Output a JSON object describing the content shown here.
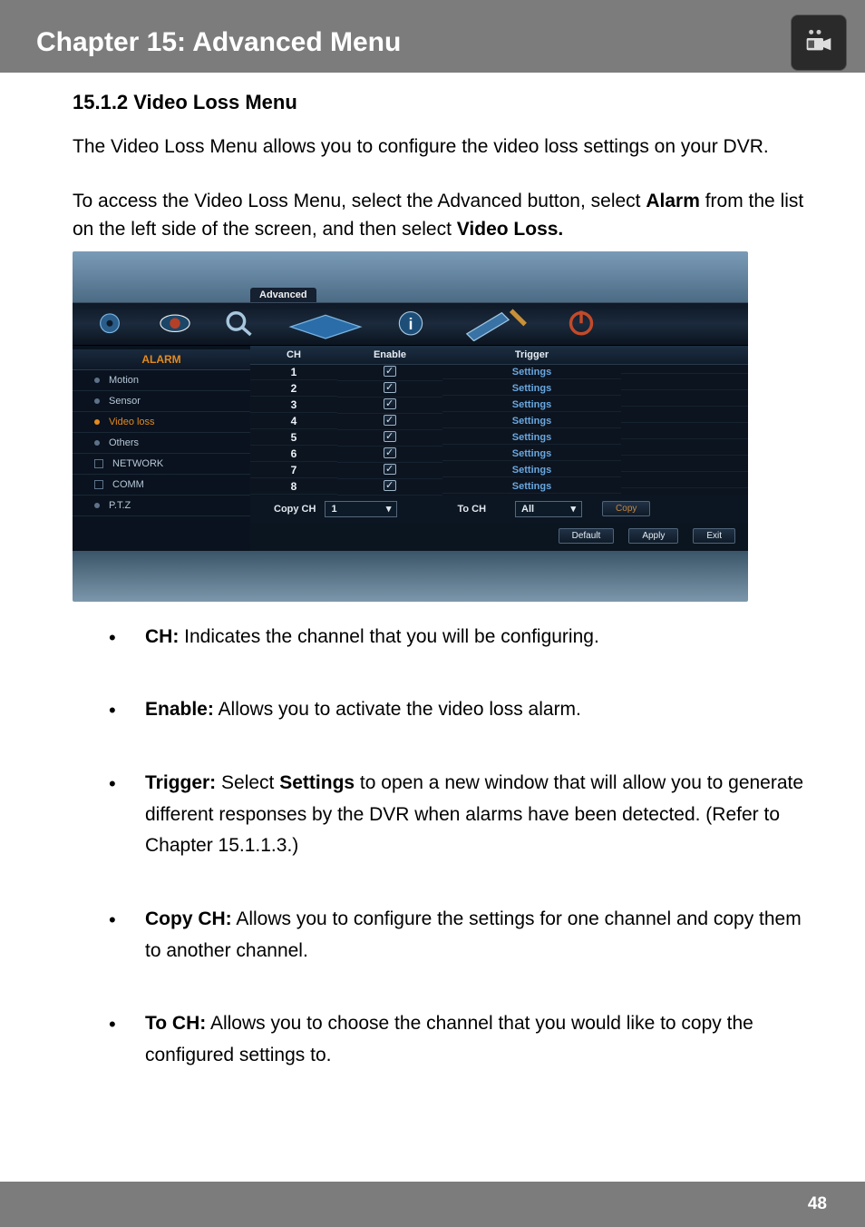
{
  "header": {
    "title": "Chapter 15: Advanced Menu"
  },
  "section": {
    "heading": "15.1.2 Video Loss Menu",
    "intro": "The Video Loss Menu allows you to configure the video loss settings on your DVR.",
    "instr_pre": "To access the Video Loss Menu, select the Advanced button, select ",
    "instr_b1": "Alarm",
    "instr_mid": " from the list on the left side of the screen, and then select ",
    "instr_b2": "Video Loss."
  },
  "dvr": {
    "window_title": "Advanced",
    "sidebar": {
      "heading": "ALARM",
      "items": [
        {
          "label": "Motion",
          "active": false
        },
        {
          "label": "Sensor",
          "active": false
        },
        {
          "label": "Video loss",
          "active": true
        },
        {
          "label": "Others",
          "active": false
        },
        {
          "label": "NETWORK",
          "active": false,
          "net": true
        },
        {
          "label": "COMM",
          "active": false,
          "net": true
        },
        {
          "label": "P.T.Z",
          "active": false
        }
      ]
    },
    "table": {
      "col_ch": "CH",
      "col_enable": "Enable",
      "col_trigger": "Trigger",
      "rows": [
        {
          "ch": "1",
          "trigger": "Settings"
        },
        {
          "ch": "2",
          "trigger": "Settings"
        },
        {
          "ch": "3",
          "trigger": "Settings"
        },
        {
          "ch": "4",
          "trigger": "Settings"
        },
        {
          "ch": "5",
          "trigger": "Settings"
        },
        {
          "ch": "6",
          "trigger": "Settings"
        },
        {
          "ch": "7",
          "trigger": "Settings"
        },
        {
          "ch": "8",
          "trigger": "Settings"
        }
      ]
    },
    "footer": {
      "copy_ch_label": "Copy CH",
      "copy_ch_value": "1",
      "to_ch_label": "To CH",
      "to_ch_value": "All",
      "copy_btn": "Copy",
      "default_btn": "Default",
      "apply_btn": "Apply",
      "exit_btn": "Exit"
    }
  },
  "bullets": {
    "b1_k": "CH:",
    "b1_v": " Indicates the channel that you will be configuring.",
    "b2_k": "Enable:",
    "b2_v": " Allows you to activate the video loss alarm.",
    "b3_k": "Trigger:",
    "b3_v1": " Select ",
    "b3_kb": "Settings",
    "b3_v2": " to open a new window that will allow you to generate different responses by the DVR when alarms have been detected. (Refer to Chapter 15.1.1.3.)",
    "b4_k": "Copy CH:",
    "b4_v": " Allows you to configure the settings for one channel and copy them to another channel.",
    "b5_k": "To CH:",
    "b5_v": " Allows you to choose the channel that you would like to copy the configured settings to."
  },
  "page_number": "48"
}
